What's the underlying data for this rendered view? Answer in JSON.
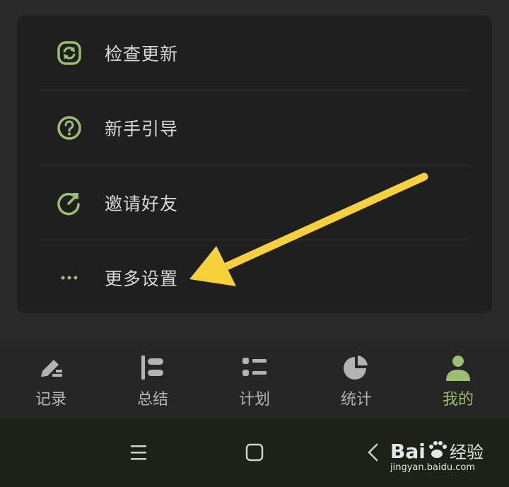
{
  "menu": {
    "items": [
      {
        "label": "检查更新",
        "icon": "refresh-icon"
      },
      {
        "label": "新手引导",
        "icon": "question-circle-icon"
      },
      {
        "label": "邀请好友",
        "icon": "share-arrow-icon"
      },
      {
        "label": "更多设置",
        "icon": "more-dots-icon"
      }
    ]
  },
  "tabs": [
    {
      "label": "记录",
      "icon": "pen-icon",
      "active": false
    },
    {
      "label": "总结",
      "icon": "summary-icon",
      "active": false
    },
    {
      "label": "计划",
      "icon": "list-icon",
      "active": false
    },
    {
      "label": "统计",
      "icon": "pie-chart-icon",
      "active": false
    },
    {
      "label": "我的",
      "icon": "user-icon",
      "active": true
    }
  ],
  "system_nav": {
    "buttons": [
      "recent-apps-icon",
      "home-icon",
      "back-icon"
    ]
  },
  "watermark": {
    "logo_text": "Bai 经验",
    "url": "jingyan.baidu.com"
  },
  "colors": {
    "accent": "#9bbf6f",
    "annotation_arrow": "#f6d13a"
  }
}
